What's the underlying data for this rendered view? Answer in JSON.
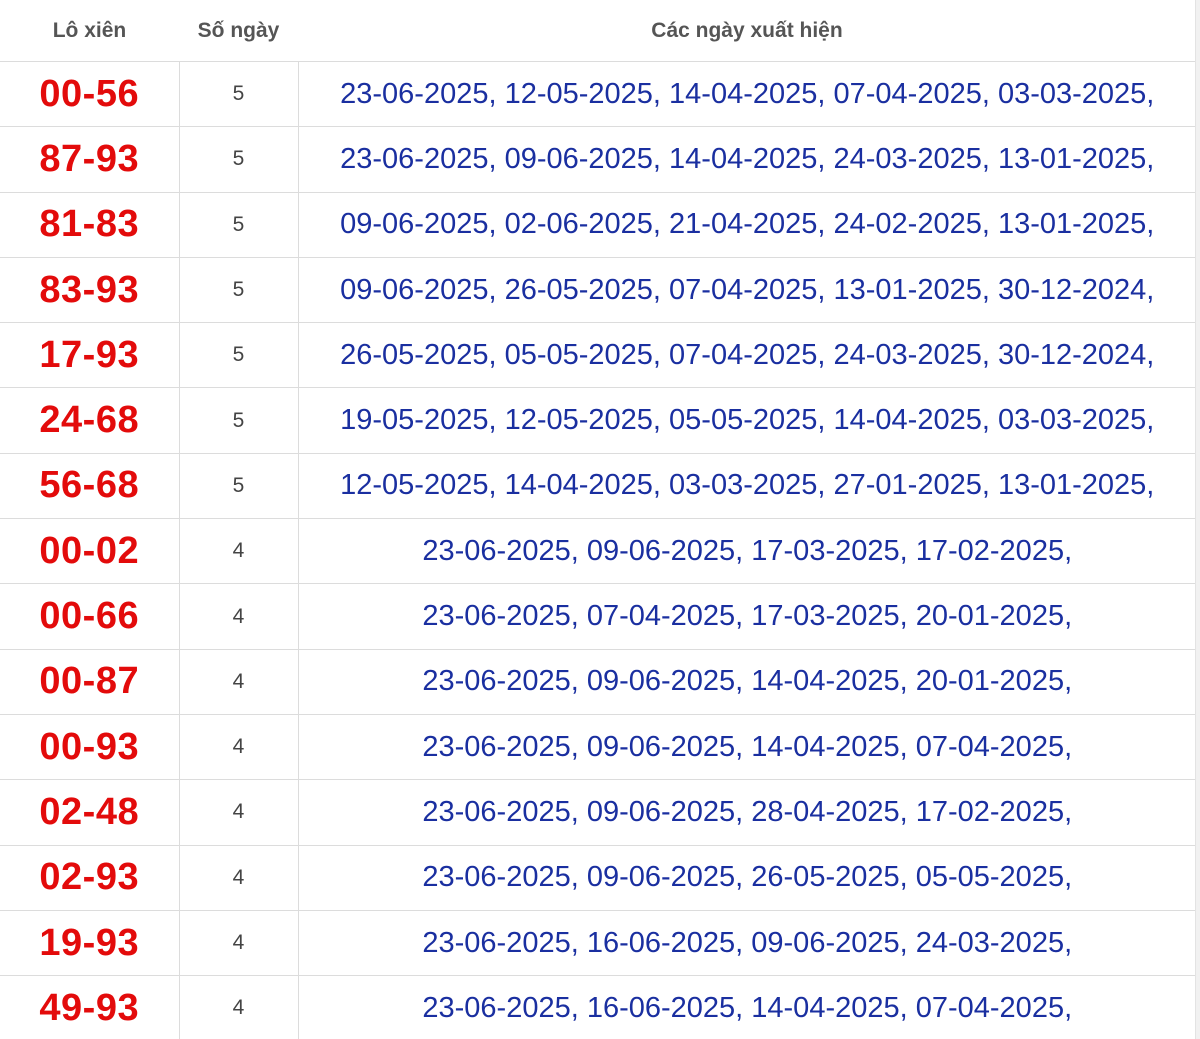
{
  "colors": {
    "pair_text": "#e30b0b",
    "dates_text": "#1a2fa0",
    "header_text": "#555555",
    "accent": "#d32f2f"
  },
  "table": {
    "headers": {
      "pair": "Lô xiên",
      "count": "Số ngày",
      "dates": "Các ngày xuất hiện"
    },
    "rows": [
      {
        "pair": "00-56",
        "count": "5",
        "dates": "23-06-2025, 12-05-2025, 14-04-2025, 07-04-2025, 03-03-2025,"
      },
      {
        "pair": "87-93",
        "count": "5",
        "dates": "23-06-2025, 09-06-2025, 14-04-2025, 24-03-2025, 13-01-2025,"
      },
      {
        "pair": "81-83",
        "count": "5",
        "dates": "09-06-2025, 02-06-2025, 21-04-2025, 24-02-2025, 13-01-2025,"
      },
      {
        "pair": "83-93",
        "count": "5",
        "dates": "09-06-2025, 26-05-2025, 07-04-2025, 13-01-2025, 30-12-2024,"
      },
      {
        "pair": "17-93",
        "count": "5",
        "dates": "26-05-2025, 05-05-2025, 07-04-2025, 24-03-2025, 30-12-2024,"
      },
      {
        "pair": "24-68",
        "count": "5",
        "dates": "19-05-2025, 12-05-2025, 05-05-2025, 14-04-2025, 03-03-2025,"
      },
      {
        "pair": "56-68",
        "count": "5",
        "dates": "12-05-2025, 14-04-2025, 03-03-2025, 27-01-2025, 13-01-2025,"
      },
      {
        "pair": "00-02",
        "count": "4",
        "dates": "23-06-2025, 09-06-2025, 17-03-2025, 17-02-2025,"
      },
      {
        "pair": "00-66",
        "count": "4",
        "dates": "23-06-2025, 07-04-2025, 17-03-2025, 20-01-2025,"
      },
      {
        "pair": "00-87",
        "count": "4",
        "dates": "23-06-2025, 09-06-2025, 14-04-2025, 20-01-2025,"
      },
      {
        "pair": "00-93",
        "count": "4",
        "dates": "23-06-2025, 09-06-2025, 14-04-2025, 07-04-2025,"
      },
      {
        "pair": "02-48",
        "count": "4",
        "dates": "23-06-2025, 09-06-2025, 28-04-2025, 17-02-2025,"
      },
      {
        "pair": "02-93",
        "count": "4",
        "dates": "23-06-2025, 09-06-2025, 26-05-2025, 05-05-2025,"
      },
      {
        "pair": "19-93",
        "count": "4",
        "dates": "23-06-2025, 16-06-2025, 09-06-2025, 24-03-2025,"
      },
      {
        "pair": "49-93",
        "count": "4",
        "dates": "23-06-2025, 16-06-2025, 14-04-2025, 07-04-2025,"
      }
    ]
  }
}
